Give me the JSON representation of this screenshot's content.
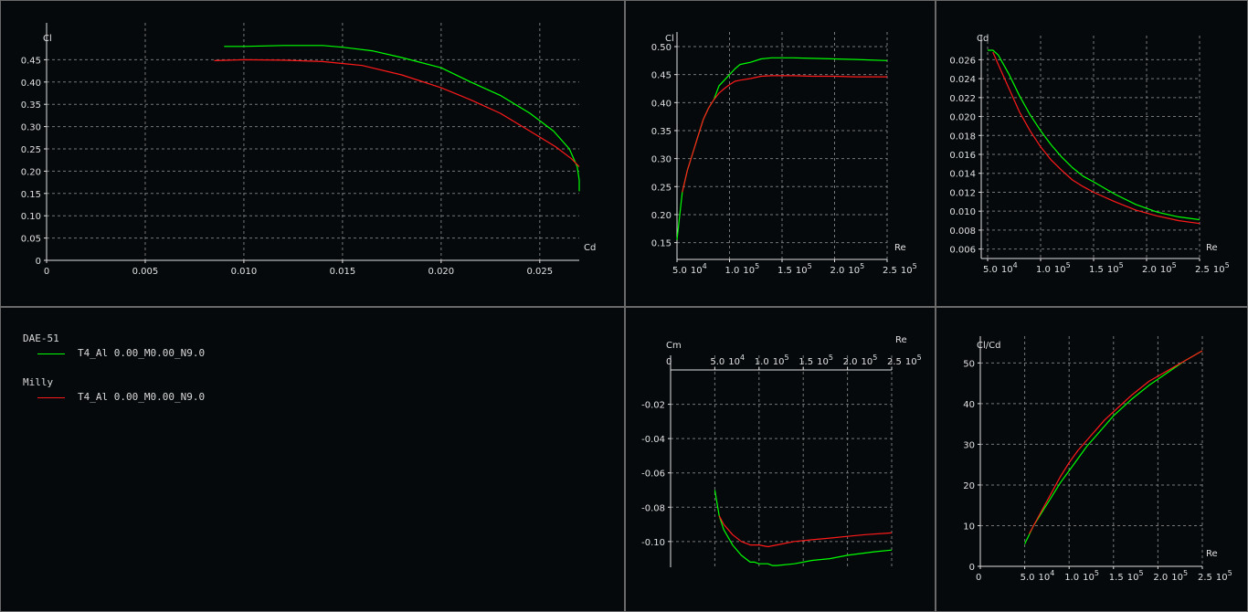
{
  "series_colors": {
    "DAE-51": "#00ff00",
    "Milly": "#ff1a1a"
  },
  "legend": {
    "items": [
      {
        "airfoil": "DAE-51",
        "polar": "T4_Al 0.00_M0.00_N9.0",
        "color": "#00ff00"
      },
      {
        "airfoil": "Milly",
        "polar": "T4_Al 0.00_M0.00_N9.0",
        "color": "#ff1a1a"
      }
    ]
  },
  "chart_data": [
    {
      "id": "cl-cd",
      "type": "line",
      "xlabel": "Cd",
      "ylabel": "Cl",
      "xlim": [
        0,
        0.027
      ],
      "ylim": [
        0,
        0.5
      ],
      "xticks": [
        0,
        0.005,
        0.01,
        0.015,
        0.02,
        0.025
      ],
      "xtick_labels": [
        "0",
        "0.005",
        "0.010",
        "0.015",
        "0.020",
        "0.025"
      ],
      "yticks": [
        0,
        0.05,
        0.1,
        0.15,
        0.2,
        0.25,
        0.3,
        0.35,
        0.4,
        0.45
      ],
      "ytick_labels": [
        "0",
        "0.05",
        "0.10",
        "0.15",
        "0.20",
        "0.25",
        "0.30",
        "0.35",
        "0.40",
        "0.45"
      ],
      "grid": true,
      "series": [
        {
          "name": "DAE-51",
          "color": "#00ff00",
          "x": [
            0.009,
            0.01,
            0.012,
            0.014,
            0.015,
            0.0165,
            0.018,
            0.02,
            0.0215,
            0.023,
            0.0245,
            0.0257,
            0.0265,
            0.0269,
            0.027,
            0.027
          ],
          "y": [
            0.48,
            0.48,
            0.482,
            0.482,
            0.478,
            0.47,
            0.455,
            0.432,
            0.4,
            0.37,
            0.33,
            0.29,
            0.25,
            0.21,
            0.18,
            0.155
          ]
        },
        {
          "name": "Milly",
          "color": "#ff1a1a",
          "x": [
            0.0085,
            0.01,
            0.012,
            0.014,
            0.016,
            0.018,
            0.02,
            0.0215,
            0.023,
            0.0245,
            0.0258,
            0.0266,
            0.027
          ],
          "y": [
            0.448,
            0.45,
            0.449,
            0.446,
            0.437,
            0.416,
            0.387,
            0.36,
            0.33,
            0.29,
            0.255,
            0.228,
            0.21
          ]
        }
      ]
    },
    {
      "id": "cl-re",
      "type": "line",
      "xlabel": "Re",
      "ylabel": "Cl",
      "xlim": [
        50000,
        250000
      ],
      "ylim": [
        0.12,
        0.5
      ],
      "xticks": [
        50000,
        100000,
        150000,
        200000,
        250000
      ],
      "xtick_labels": [
        [
          "5.0",
          "10",
          "4"
        ],
        [
          "1.0",
          "10",
          "5"
        ],
        [
          "1.5",
          "10",
          "5"
        ],
        [
          "2.0",
          "10",
          "5"
        ],
        [
          "2.5",
          "10",
          "5"
        ]
      ],
      "yticks": [
        0.15,
        0.2,
        0.25,
        0.3,
        0.35,
        0.4,
        0.45,
        0.5
      ],
      "ytick_labels": [
        "0.15",
        "0.20",
        "0.25",
        "0.30",
        "0.35",
        "0.40",
        "0.45",
        "0.50"
      ],
      "grid": true,
      "series": [
        {
          "name": "DAE-51",
          "color": "#00ff00",
          "x": [
            50000,
            55000,
            60000,
            65000,
            70000,
            75000,
            80000,
            85000,
            90000,
            95000,
            100000,
            105000,
            110000,
            115000,
            120000,
            130000,
            140000,
            160000,
            180000,
            200000,
            220000,
            250000
          ],
          "y": [
            0.155,
            0.24,
            0.28,
            0.31,
            0.34,
            0.37,
            0.39,
            0.405,
            0.43,
            0.44,
            0.45,
            0.46,
            0.468,
            0.47,
            0.472,
            0.478,
            0.48,
            0.48,
            0.479,
            0.478,
            0.477,
            0.475
          ]
        },
        {
          "name": "Milly",
          "color": "#ff1a1a",
          "x": [
            55000,
            60000,
            65000,
            70000,
            75000,
            80000,
            85000,
            90000,
            95000,
            100000,
            105000,
            110000,
            120000,
            130000,
            140000,
            160000,
            180000,
            200000,
            220000,
            250000
          ],
          "y": [
            0.24,
            0.28,
            0.31,
            0.34,
            0.37,
            0.39,
            0.405,
            0.417,
            0.425,
            0.432,
            0.438,
            0.44,
            0.443,
            0.447,
            0.448,
            0.448,
            0.447,
            0.447,
            0.446,
            0.446
          ]
        }
      ]
    },
    {
      "id": "cd-re",
      "type": "line",
      "xlabel": "Re",
      "ylabel": "Cd",
      "xlim": [
        50000,
        250000
      ],
      "ylim": [
        0.005,
        0.027
      ],
      "xticks": [
        50000,
        100000,
        150000,
        200000,
        250000
      ],
      "xtick_labels": [
        [
          "5.0",
          "10",
          "4"
        ],
        [
          "1.0",
          "10",
          "5"
        ],
        [
          "1.5",
          "10",
          "5"
        ],
        [
          "2.0",
          "10",
          "5"
        ],
        [
          "2.5",
          "10",
          "5"
        ]
      ],
      "yticks": [
        0.006,
        0.008,
        0.01,
        0.012,
        0.014,
        0.016,
        0.018,
        0.02,
        0.022,
        0.024,
        0.026
      ],
      "ytick_labels": [
        "0.006",
        "0.008",
        "0.010",
        "0.012",
        "0.014",
        "0.016",
        "0.018",
        "0.020",
        "0.022",
        "0.024",
        "0.026"
      ],
      "grid": true,
      "series": [
        {
          "name": "DAE-51",
          "color": "#00ff00",
          "x": [
            50000,
            55000,
            60000,
            70000,
            80000,
            90000,
            100000,
            110000,
            120000,
            130000,
            140000,
            150000,
            170000,
            190000,
            210000,
            230000,
            250000
          ],
          "y": [
            0.027,
            0.027,
            0.0265,
            0.0245,
            0.0222,
            0.0202,
            0.0185,
            0.017,
            0.0157,
            0.0146,
            0.0137,
            0.0131,
            0.0118,
            0.0107,
            0.0099,
            0.0094,
            0.0091
          ]
        },
        {
          "name": "Milly",
          "color": "#ff1a1a",
          "x": [
            55000,
            60000,
            70000,
            80000,
            90000,
            100000,
            110000,
            120000,
            130000,
            140000,
            150000,
            170000,
            190000,
            210000,
            230000,
            250000
          ],
          "y": [
            0.0268,
            0.0255,
            0.023,
            0.0205,
            0.0185,
            0.0168,
            0.0154,
            0.0143,
            0.0133,
            0.0126,
            0.012,
            0.011,
            0.0101,
            0.0095,
            0.009,
            0.0087
          ]
        }
      ]
    },
    {
      "id": "cm-re",
      "type": "line",
      "xlabel": "Re",
      "ylabel": "Cm",
      "xlim": [
        0,
        250000
      ],
      "ylim": [
        -0.115,
        0
      ],
      "xticks": [
        0,
        50000,
        100000,
        150000,
        200000,
        250000
      ],
      "xtick_labels": [
        [
          "0",
          "",
          ""
        ],
        [
          "5.0",
          "10",
          "4"
        ],
        [
          "1.0",
          "10",
          "5"
        ],
        [
          "1.5",
          "10",
          "5"
        ],
        [
          "2.0",
          "10",
          "5"
        ],
        [
          "2.5",
          "10",
          "5"
        ]
      ],
      "yticks": [
        -0.02,
        -0.04,
        -0.06,
        -0.08,
        -0.1
      ],
      "ytick_labels": [
        "-0.02",
        "-0.04",
        "-0.06",
        "-0.08",
        "-0.10"
      ],
      "grid": true,
      "series": [
        {
          "name": "DAE-51",
          "color": "#00ff00",
          "x": [
            50000,
            55000,
            60000,
            70000,
            80000,
            90000,
            95000,
            100000,
            110000,
            115000,
            120000,
            140000,
            160000,
            180000,
            200000,
            230000,
            250000
          ],
          "y": [
            -0.07,
            -0.085,
            -0.093,
            -0.102,
            -0.108,
            -0.112,
            -0.112,
            -0.113,
            -0.113,
            -0.114,
            -0.114,
            -0.113,
            -0.111,
            -0.11,
            -0.108,
            -0.106,
            -0.105
          ]
        },
        {
          "name": "Milly",
          "color": "#ff1a1a",
          "x": [
            55000,
            60000,
            70000,
            80000,
            90000,
            100000,
            110000,
            120000,
            140000,
            160000,
            180000,
            200000,
            220000,
            250000
          ],
          "y": [
            -0.085,
            -0.09,
            -0.096,
            -0.1,
            -0.102,
            -0.102,
            -0.103,
            -0.102,
            -0.1,
            -0.099,
            -0.098,
            -0.097,
            -0.096,
            -0.095
          ]
        }
      ]
    },
    {
      "id": "clcd-re",
      "type": "line",
      "xlabel": "Re",
      "ylabel": "Cl/Cd",
      "xlim": [
        0,
        250000
      ],
      "ylim": [
        0,
        53
      ],
      "xticks": [
        0,
        50000,
        100000,
        150000,
        200000,
        250000
      ],
      "xtick_labels": [
        [
          "0",
          "",
          ""
        ],
        [
          "5.0",
          "10",
          "4"
        ],
        [
          "1.0",
          "10",
          "5"
        ],
        [
          "1.5",
          "10",
          "5"
        ],
        [
          "2.0",
          "10",
          "5"
        ],
        [
          "2.5",
          "10",
          "5"
        ]
      ],
      "yticks": [
        0,
        10,
        20,
        30,
        40,
        50
      ],
      "ytick_labels": [
        "0",
        "10",
        "20",
        "30",
        "40",
        "50"
      ],
      "grid": true,
      "series": [
        {
          "name": "DAE-51",
          "color": "#00ff00",
          "x": [
            50000,
            60000,
            70000,
            80000,
            90000,
            100000,
            110000,
            120000,
            130000,
            140000,
            150000,
            170000,
            190000,
            210000,
            230000,
            250000
          ],
          "y": [
            5.5,
            10,
            13.5,
            17,
            20.5,
            23.5,
            26.5,
            29.5,
            32,
            34.5,
            37,
            41,
            44.5,
            47.5,
            50.5,
            53
          ]
        },
        {
          "name": "Milly",
          "color": "#ff1a1a",
          "x": [
            55000,
            60000,
            70000,
            80000,
            90000,
            100000,
            110000,
            120000,
            130000,
            140000,
            150000,
            170000,
            190000,
            210000,
            230000,
            250000
          ],
          "y": [
            8,
            10,
            14,
            18,
            22,
            25.5,
            28.5,
            31,
            33.5,
            36,
            38,
            42,
            45.5,
            48,
            50.5,
            53
          ]
        }
      ]
    }
  ]
}
